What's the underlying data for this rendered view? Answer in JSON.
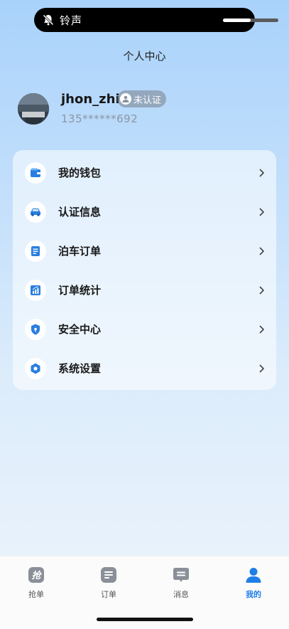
{
  "status": {
    "label": "铃声",
    "volume_fraction": 0.5
  },
  "header": {
    "title": "个人中心"
  },
  "profile": {
    "username": "jhon_zhi",
    "badge": "未认证",
    "phone": "135******692"
  },
  "menu": {
    "items": [
      {
        "label": "我的钱包",
        "icon": "wallet-icon"
      },
      {
        "label": "认证信息",
        "icon": "car-icon"
      },
      {
        "label": "泊车订单",
        "icon": "document-icon"
      },
      {
        "label": "订单统计",
        "icon": "chart-icon"
      },
      {
        "label": "安全中心",
        "icon": "shield-icon"
      },
      {
        "label": "系统设置",
        "icon": "settings-icon"
      }
    ]
  },
  "tabs": [
    {
      "label": "抢单",
      "icon": "grab-icon",
      "active": false
    },
    {
      "label": "订单",
      "icon": "order-list-icon",
      "active": false
    },
    {
      "label": "消息",
      "icon": "message-icon",
      "active": false
    },
    {
      "label": "我的",
      "icon": "user-icon",
      "active": true
    }
  ],
  "colors": {
    "accent": "#1e7fe6",
    "icon_blue": "#2a7ee0",
    "inactive_tab": "#8a8f98"
  }
}
